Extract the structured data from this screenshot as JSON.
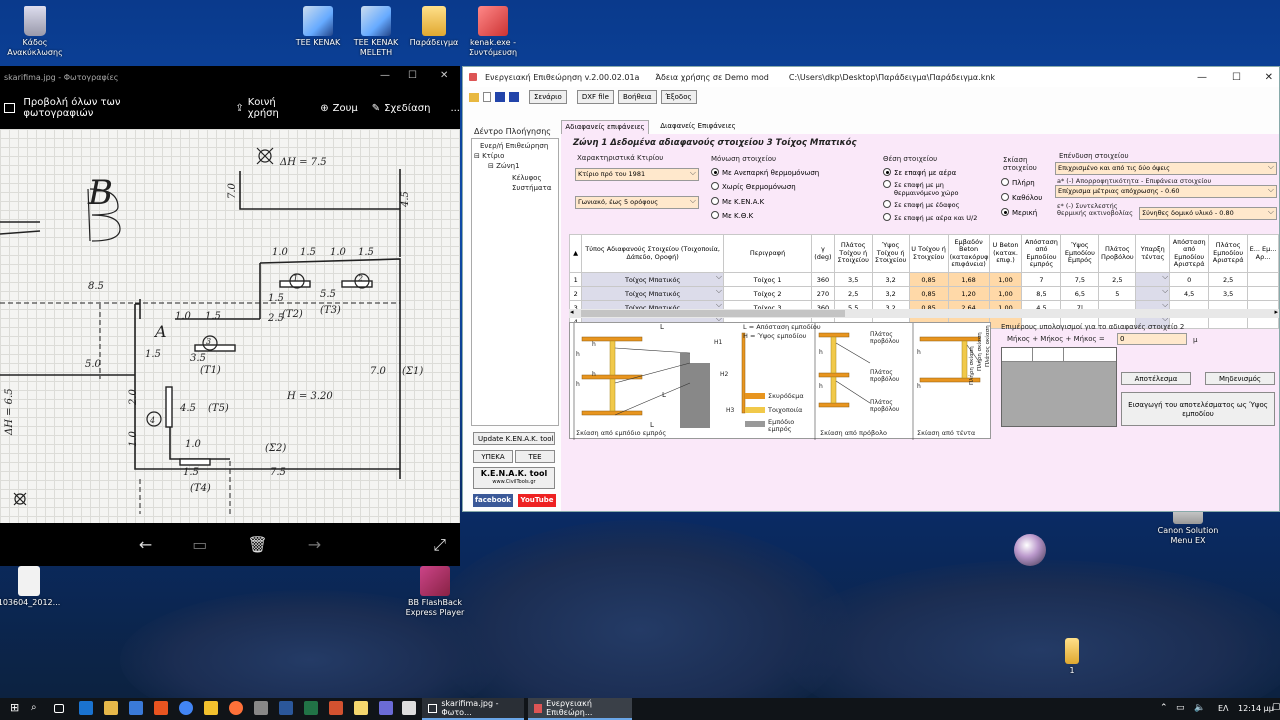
{
  "desktop": {
    "icons": [
      {
        "label": "Κάδος Ανακύκλωσης",
        "icon": "recycle-bin-icon"
      },
      {
        "label": "TEE KENAK",
        "icon": "house-app-icon"
      },
      {
        "label": "TEE KENAK MELETH",
        "icon": "house-app-icon"
      },
      {
        "label": "Παράδειγμα",
        "icon": "folder-icon"
      },
      {
        "label": "kenak.exe - Συντόμευση",
        "icon": "shortcut-icon"
      },
      {
        "label": "103604_2012...",
        "icon": "document-icon"
      },
      {
        "label": "BB FlashBack Express Player",
        "icon": "video-player-icon"
      },
      {
        "label": "Canon Solution Menu EX",
        "icon": "printer-icon"
      },
      {
        "label": "1",
        "icon": "folder-icon"
      }
    ]
  },
  "photos": {
    "title": "skarifima.jpg - Φωτογραφίες",
    "view_all": "Προβολή όλων των φωτογραφιών",
    "share": "Κοινή χρήση",
    "zoom": "Ζουμ",
    "draw": "Σχεδίαση",
    "more": "...",
    "sketch_labels": [
      "ΔΗ = 7.5",
      "B",
      "7.0",
      "4.5",
      "1.0",
      "1.5",
      "1.0",
      "1.5",
      "8.5",
      "1.5",
      "5.5",
      "(Τ3)",
      "(Τ2)",
      "2.5",
      "1.0",
      "1.5",
      "A",
      "1.5",
      "3.5",
      "(Τ1)",
      "5.0",
      "7.0",
      "(Σ1)",
      "H = 3.20",
      "4.5",
      "(Τ5)",
      "ΔΗ = 6.5",
      "2.0",
      "1.0",
      "1.0",
      "(Σ2)",
      "1.5",
      "7.5",
      "(Τ4)",
      "1",
      "2",
      "3",
      "4"
    ]
  },
  "app": {
    "title": "Ενεργειακή Επιθεώρηση v.2.00.02.01a",
    "license": "Άδεια χρήσης σε  Demo mod",
    "path": "C:\\Users\\dkp\\Desktop\\Παράδειγμα\\Παράδειγμα.knk",
    "menu": [
      "Σενάριο",
      "DXF file",
      "Βοήθεια",
      "Έξοδος"
    ],
    "tree_title": "Δέντρο Πλοήγησης",
    "tree": [
      "Ενερ/ή Επιθεώρηση",
      "Κτίριο",
      "Ζώνη1",
      "Κέλυφος",
      "Συστήματα"
    ],
    "tabs": [
      "Αδιαφανείς επιφάνειες",
      "Διαφανείς Επιφάνειες"
    ],
    "heading": "Ζώνη 1  Δεδομένα αδιαφανούς στοιχείου  3  Τοίχος Μπατικός",
    "building_label": "Χαρακτηριστικά Κτιρίου",
    "building_type": "Κτίριο πρό του 1981",
    "building_floors": "Γωνιακό, έως 5 ορόφους",
    "insulation_label": "Μόνωση στοιχείου",
    "insulation_options": [
      "Με Ανεπαρκή θερμομόνωση",
      "Χωρίς Θερμομόνωση",
      "Με K.EN.A.K",
      "Με Κ.Θ.Κ"
    ],
    "position_label": "Θέση στοιχείου",
    "position_options": [
      "Σε επαφή με αέρα",
      "Σε επαφή με μη θερμαινόμενο χώρο",
      "Σε επαφή με έδαφος",
      "Σε επαφή με αέρα και U/2"
    ],
    "shading_label": "Σκίαση στοιχείου",
    "shading_options": [
      "Πλήρη",
      "Καθόλου",
      "Μερική"
    ],
    "coating_label": "Επένδυση στοιχείου",
    "coating_value": "Επιχρισμένο και από τις δύο όψεις",
    "absorb_label": "a* (-) Απορροφητικότητα - Επιφάνεια στοιχείου",
    "absorb_value": "Επίχρισμα μέτριας απόχρωσης - 0.60",
    "emiss_label": "ε* (-) Συντελεστής θερμικής ακτινοβολίας",
    "emiss_value": "Σύνηθες δομικό υλικό - 0.80",
    "columns": [
      "Τύπος Αδιαφανούς Στοιχείου (Τοιχοποιία, Δάπεδο, Οροφή)",
      "Περιγραφή",
      "γ (deg)",
      "Πλάτος Τοίχου ή Στοιχείου",
      "Ύψος Τοίχου ή Στοιχείου",
      "U Τοίχου ή Στοιχείου",
      "Εμβαδόν Beton (κατακόρυφη επιφάνεια)",
      "U Beton (κατακ. επιφ.)",
      "Απόσταση από Εμποδίου εμπρός",
      "Ύψος Εμποδίου Εμπρός",
      "Πλάτος Προβόλου",
      "Υπαρξη τέντας",
      "Απόσταση από Εμποδίου Αριστερά",
      "Πλάτος Εμποδίου Αριστερά",
      "Ε... Εμ... Αρ..."
    ],
    "rows": [
      {
        "n": "1",
        "type": "Τοίχος Μπατικός",
        "desc": "Τοίχος 1",
        "deg": "360",
        "w": "3,5",
        "h": "3,2",
        "u": "0,85",
        "area": "1,68",
        "ub": "1,00",
        "d": "7",
        "hf": "7,5",
        "pb": "2,5",
        "td": "",
        "dl": "0",
        "wl": "2,5"
      },
      {
        "n": "2",
        "type": "Τοίχος Μπατικός",
        "desc": "Τοίχος 2",
        "deg": "270",
        "w": "2,5",
        "h": "3,2",
        "u": "0,85",
        "area": "1,20",
        "ub": "1,00",
        "d": "8,5",
        "hf": "6,5",
        "pb": "5",
        "td": "",
        "dl": "4,5",
        "wl": "3,5"
      },
      {
        "n": "3",
        "type": "Τοίχος Μπατικός",
        "desc": "Τοίχος 3",
        "deg": "360",
        "w": "5,5",
        "h": "3,2",
        "u": "0,85",
        "area": "2,64",
        "ub": "1,00",
        "d": "4,5",
        "hf": "7|",
        "pb": "",
        "td": "",
        "dl": "",
        "wl": ""
      },
      {
        "n": "4",
        "type": "",
        "desc": "",
        "deg": "",
        "w": "",
        "h": "",
        "u": "",
        "area": "",
        "ub": "",
        "d": "",
        "hf": "",
        "pb": "",
        "td": "",
        "dl": "",
        "wl": ""
      }
    ],
    "side_buttons": [
      "Update K.EN.A.K. tool",
      "ΥΠΕΚΑ",
      "TEE",
      "K.E.N.A.K. tool",
      "www.CivilTools.gr",
      "facebook",
      "YouTube"
    ],
    "legend": [
      "L = Απόσταση εμποδίου",
      "H = Ύψος εμποδίου",
      "Σκυρόδεμα",
      "Τοιχοποιία",
      "Εμπόδιο εμπρός"
    ],
    "diagram_captions": [
      "Σκίαση από εμπόδιο εμπρός",
      "Σκίαση από πρόβολο",
      "Σκίαση από τέντα"
    ],
    "diagram_labels": [
      "Πλάτος προβόλου",
      "Πλάτος προβόλου",
      "Πλάτος προβόλου",
      "Πλήρη σκίαση",
      "Πλήρη σκίαση",
      "Πλάτος οκίαση"
    ],
    "diag_dims": [
      "L",
      "L",
      "L",
      "H1",
      "H2",
      "H3",
      "h",
      "h",
      "h",
      "h",
      "h",
      "h",
      "h",
      "h"
    ],
    "calc_title": "Επιμέρους υπολογισμοί για το αδιαφανές στοιχείο 2",
    "calc_formula": "Μήκος + Μήκος + Μήκος   =",
    "calc_value": "0",
    "calc_unit": "μ",
    "calc_result": "Αποτέλεσμα",
    "calc_reset": "Μηδενισμός",
    "calc_insert": "Εισαγωγή του αποτελέσματος ως Ύψος εμποδίου"
  },
  "taskbar": {
    "tasks": [
      "skarifima.jpg - Φωτο...",
      "Ενεργειακή Επιθεώρη..."
    ],
    "lang": "ΕΛ",
    "time": "12:14 μμ"
  },
  "colors": {
    "panel": "#fae8f9",
    "field": "#ffe8cc",
    "cell_orange": "#ffd9a8",
    "taskbar": "#101418"
  }
}
